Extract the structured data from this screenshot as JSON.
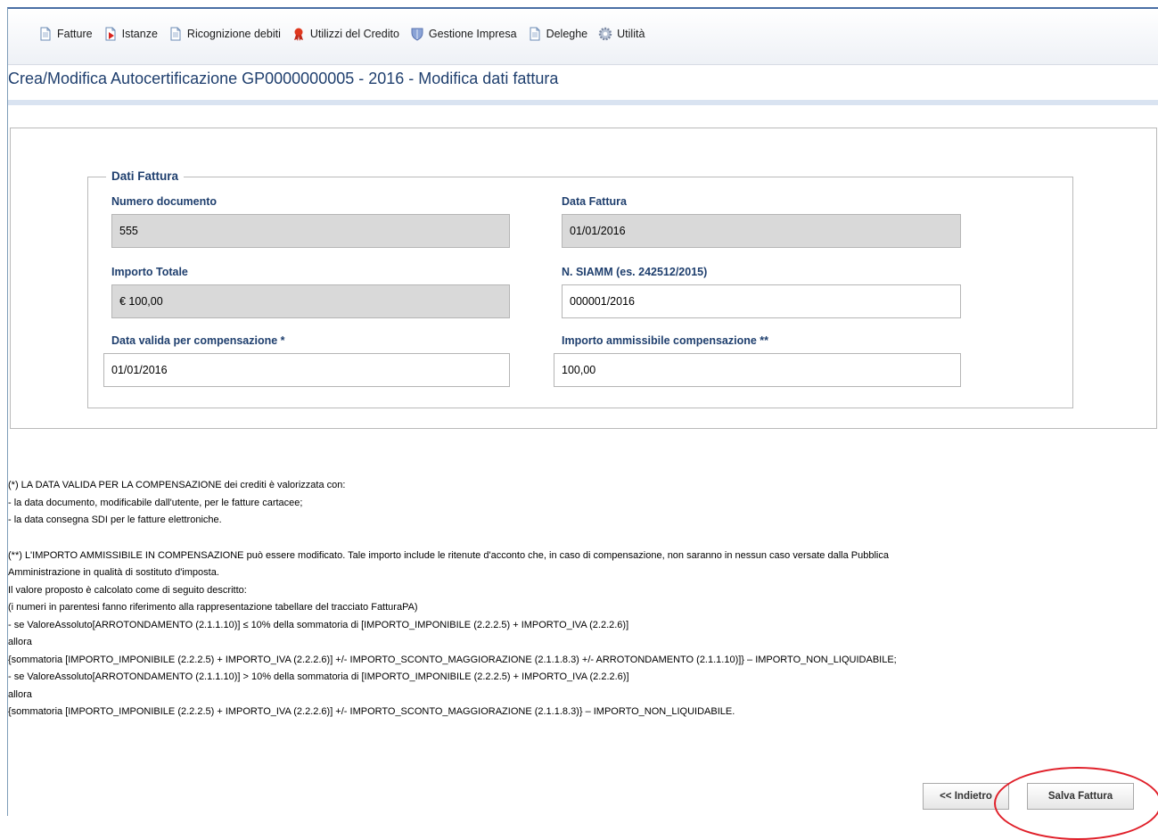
{
  "nav": {
    "items": [
      {
        "label": "Fatture",
        "icon": "document-icon"
      },
      {
        "label": "Istanze",
        "icon": "document-red-icon"
      },
      {
        "label": "Ricognizione debiti",
        "icon": "document-icon"
      },
      {
        "label": "Utilizzi del Credito",
        "icon": "ribbon-icon"
      },
      {
        "label": "Gestione Impresa",
        "icon": "shield-icon"
      },
      {
        "label": "Deleghe",
        "icon": "document-icon"
      },
      {
        "label": "Utilità",
        "icon": "gear-icon"
      }
    ]
  },
  "page_title": "Crea/Modifica Autocertificazione GP0000000005 - 2016 - Modifica dati fattura",
  "form": {
    "legend": "Dati Fattura",
    "numero_documento": {
      "label": "Numero documento",
      "value": "555"
    },
    "data_fattura": {
      "label": "Data Fattura",
      "value": "01/01/2016"
    },
    "importo_totale": {
      "label": "Importo Totale",
      "value": "€ 100,00"
    },
    "siamm": {
      "label": "N. SIAMM (es. 242512/2015)",
      "value": "000001/2016"
    },
    "data_valida": {
      "label": "Data valida per compensazione *",
      "value": "01/01/2016"
    },
    "importo_ammissibile": {
      "label": "Importo ammissibile compensazione **",
      "value": "100,00"
    }
  },
  "notes": {
    "block1": [
      "(*) LA DATA VALIDA PER LA COMPENSAZIONE dei crediti è valorizzata con:",
      "- la data documento, modificabile dall'utente, per le fatture cartacee;",
      "- la data consegna SDI per le fatture elettroniche."
    ],
    "block2": [
      "(**) L'IMPORTO AMMISSIBILE IN COMPENSAZIONE può essere modificato. Tale importo include le ritenute d'acconto che, in caso di compensazione, non saranno in nessun caso versate dalla Pubblica",
      "Amministrazione in qualità di sostituto d'imposta.",
      "Il valore proposto è calcolato come di seguito descritto:",
      "(i numeri in parentesi fanno riferimento alla rappresentazione tabellare del tracciato FatturaPA)",
      "- se ValoreAssoluto[ARROTONDAMENTO (2.1.1.10)] ≤ 10% della sommatoria di [IMPORTO_IMPONIBILE (2.2.2.5) + IMPORTO_IVA (2.2.2.6)]",
      "allora",
      "{sommatoria [IMPORTO_IMPONIBILE (2.2.2.5) + IMPORTO_IVA (2.2.2.6)] +/- IMPORTO_SCONTO_MAGGIORAZIONE (2.1.1.8.3) +/- ARROTONDAMENTO (2.1.1.10)]} – IMPORTO_NON_LIQUIDABILE;",
      "- se ValoreAssoluto[ARROTONDAMENTO (2.1.1.10)] > 10% della sommatoria di [IMPORTO_IMPONIBILE (2.2.2.5) + IMPORTO_IVA (2.2.2.6)]",
      "allora",
      "{sommatoria [IMPORTO_IMPONIBILE (2.2.2.5) + IMPORTO_IVA (2.2.2.6)] +/- IMPORTO_SCONTO_MAGGIORAZIONE (2.1.1.8.3)} – IMPORTO_NON_LIQUIDABILE."
    ]
  },
  "buttons": {
    "back": "<< Indietro",
    "save": "Salva Fattura"
  },
  "colors": {
    "accent": "#1f3f6e",
    "readonly_field": "#d9d9d9",
    "highlight_circle": "#e0202a"
  }
}
